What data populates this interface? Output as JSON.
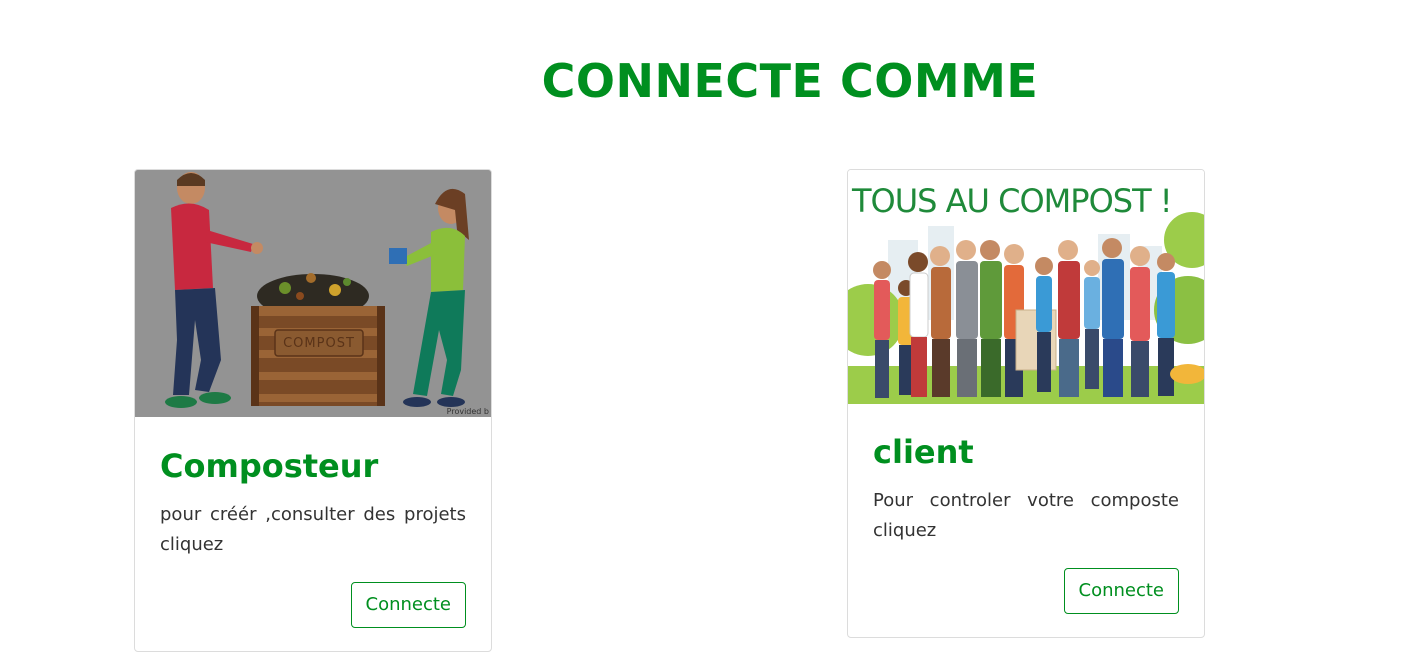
{
  "page": {
    "title": "CONNECTE COMME"
  },
  "cards": [
    {
      "title": "Composteur",
      "text": "pour créér ,consulter des projets cliquez",
      "button_label": "Connecte",
      "image": {
        "sign_text": "COMPOST",
        "credit_text": "Provided b"
      }
    },
    {
      "title": "client",
      "text": "Pour controler votre composte cliquez",
      "button_label": "Connecte",
      "image": {
        "banner_text": "TOUS AU COMPOST !"
      }
    }
  ],
  "colors": {
    "brand_green": "#008f1f",
    "body_text": "#333333",
    "card_border": "#dcdcdc"
  }
}
